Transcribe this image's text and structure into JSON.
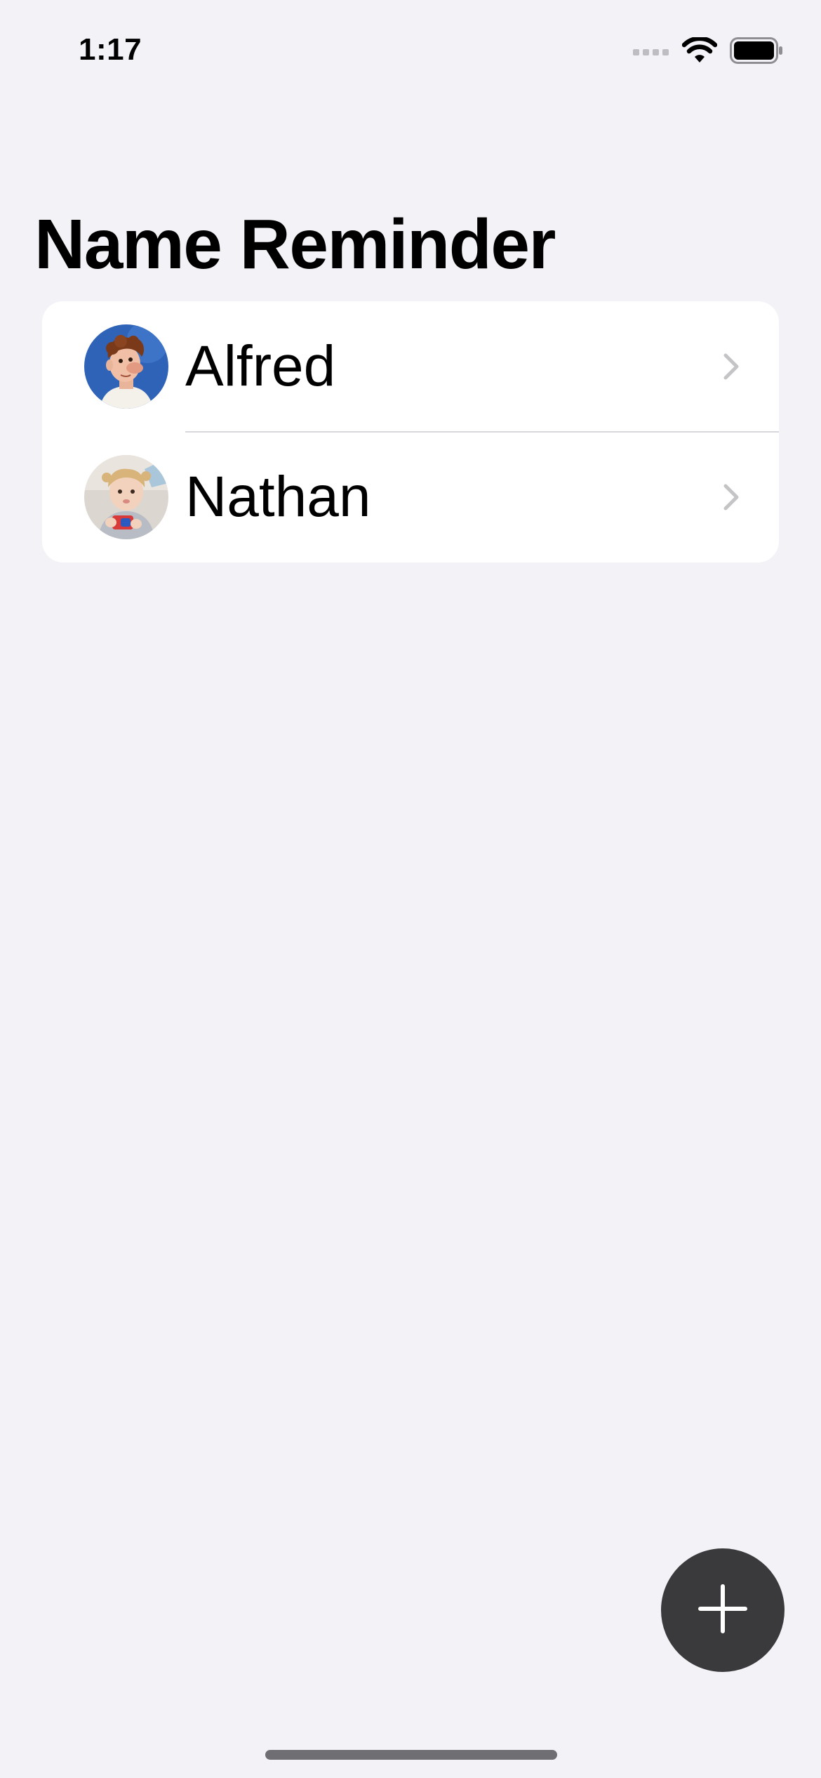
{
  "status_bar": {
    "time": "1:17",
    "icons": [
      "cellular-signal-icon",
      "wifi-icon",
      "battery-icon"
    ]
  },
  "header": {
    "title": "Name Reminder"
  },
  "people": [
    {
      "name": "Alfred",
      "avatar": "cartoon-chef-avatar",
      "accessory": "chevron-right-icon"
    },
    {
      "name": "Nathan",
      "avatar": "toddler-photo-avatar",
      "accessory": "chevron-right-icon"
    }
  ],
  "add_button": {
    "icon": "plus-icon"
  },
  "colors": {
    "background": "#F2F2F7",
    "card": "#FFFFFF",
    "fab": "#3A3A3C",
    "chevron": "#C4C4C7",
    "separator": "#D7D7DC"
  }
}
